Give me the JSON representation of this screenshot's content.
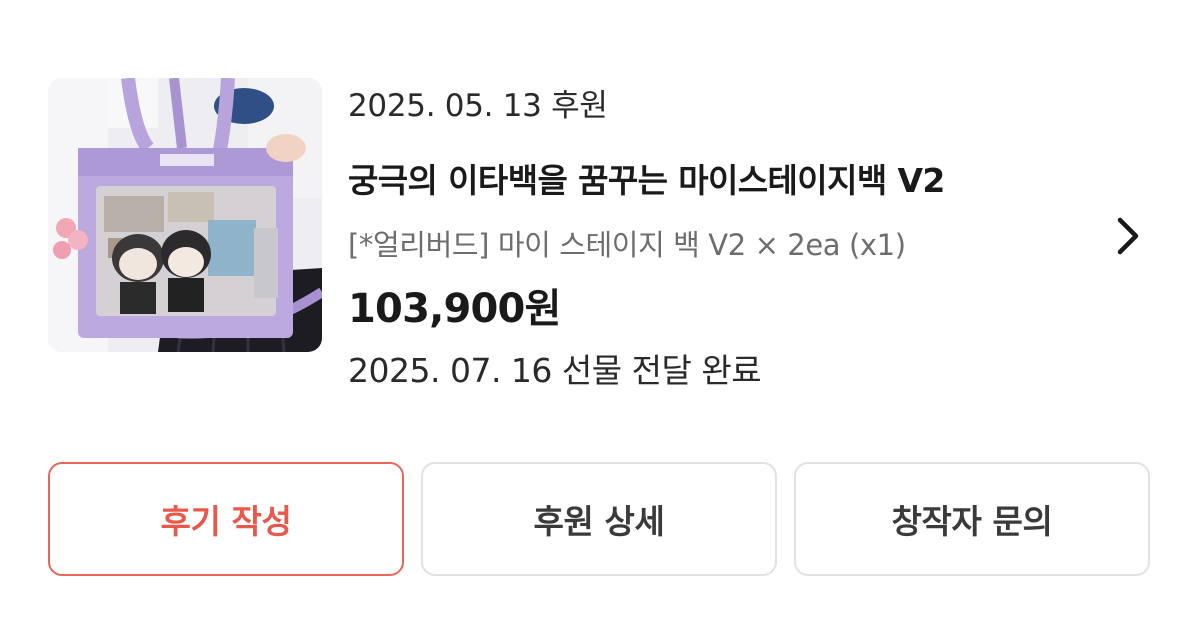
{
  "order": {
    "sponsor_date": "2025. 05. 13 후원",
    "title": "궁극의 이타백을 꿈꾸는 마이스테이지백 V2",
    "option": "[*얼리버드] 마이 스테이지 백 V2 × 2ea (x1)",
    "price": "103,900원",
    "delivery_status": "2025. 07. 16 선물 전달 완료",
    "thumbnail_icon": "product-photo-purple-tote-bag",
    "chevron_icon": "chevron-right-icon"
  },
  "actions": {
    "review_label": "후기 작성",
    "detail_label": "후원 상세",
    "inquiry_label": "창작자 문의"
  },
  "colors": {
    "accent": "#e8584b",
    "border": "#e2e2e2",
    "bag_purple": "#b9a6dc"
  }
}
